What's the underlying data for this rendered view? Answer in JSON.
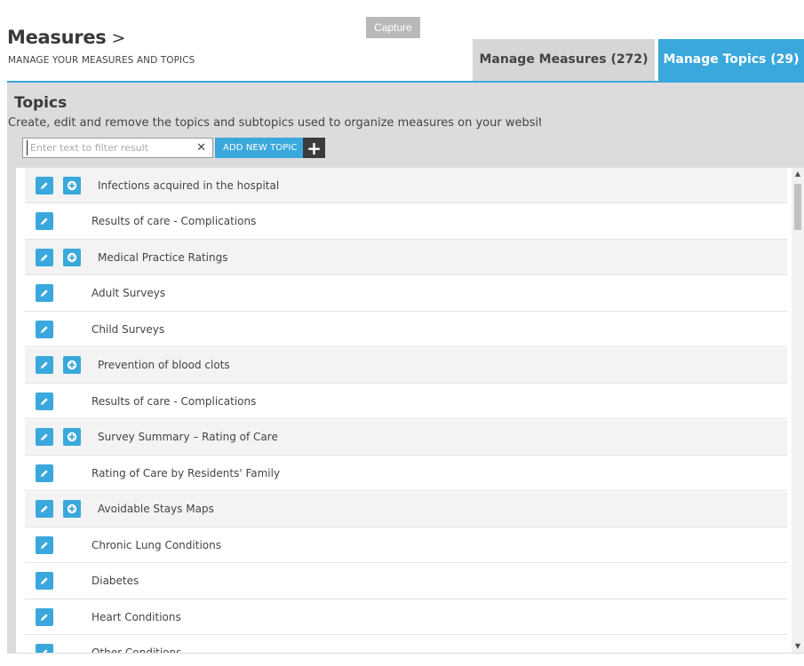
{
  "capture_label": "Capture",
  "header": {
    "title": "Measures",
    "chevron": ">",
    "subtitle": "MANAGE YOUR MEASURES AND TOPICS"
  },
  "tabs": {
    "measures_label": "Manage Measures (272)",
    "topics_label": "Manage Topics (29)"
  },
  "panel": {
    "heading": "Topics",
    "description": "Create, edit and remove the topics and subtopics used to organize measures on your website",
    "filter_placeholder": "Enter text to filter result",
    "filter_value": "",
    "clear_glyph": "✕",
    "add_topic_label": "ADD NEW TOPIC",
    "add_topic_glyph": "+"
  },
  "topics": [
    {
      "label": "Infections acquired in the hospital",
      "type": "parent"
    },
    {
      "label": "Results of care - Complications",
      "type": "child"
    },
    {
      "label": "Medical Practice Ratings",
      "type": "parent"
    },
    {
      "label": "Adult Surveys",
      "type": "child"
    },
    {
      "label": "Child Surveys",
      "type": "child"
    },
    {
      "label": "Prevention of blood clots",
      "type": "parent"
    },
    {
      "label": "Results of care - Complications",
      "type": "child"
    },
    {
      "label": "Survey Summary – Rating of Care",
      "type": "parent"
    },
    {
      "label": "Rating of Care by Residents' Family",
      "type": "child"
    },
    {
      "label": "Avoidable Stays Maps",
      "type": "parent"
    },
    {
      "label": "Chronic Lung Conditions",
      "type": "child"
    },
    {
      "label": "Diabetes",
      "type": "child"
    },
    {
      "label": "Heart Conditions",
      "type": "child"
    },
    {
      "label": "Other Conditions",
      "type": "child"
    }
  ],
  "colors": {
    "accent": "#3aa8dc",
    "tab_inactive": "#d6d6d6",
    "panel_bg": "#dcdcdc",
    "parent_row": "#f3f3f3"
  }
}
